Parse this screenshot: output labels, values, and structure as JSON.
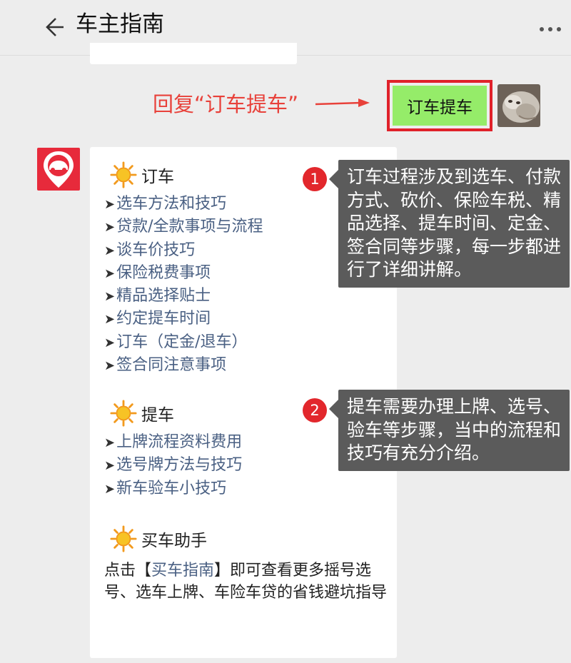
{
  "header": {
    "title": "车主指南",
    "back_icon": "back-arrow-icon",
    "more_icon": "more-dots-icon"
  },
  "annotation_reply": "回复“订车提车”",
  "sent_message": "订车提车",
  "card": {
    "section1": {
      "title": "订车",
      "items": [
        "选车方法和技巧",
        "贷款/全款事项与流程",
        "谈车价技巧",
        "保险税费事项",
        "精品选择贴士",
        "约定提车时间",
        "订车（定金/退车）",
        "签合同注意事项"
      ]
    },
    "section2": {
      "title": "提车",
      "items": [
        "上牌流程资料费用",
        "选号牌方法与技巧",
        "新车验车小技巧"
      ]
    },
    "section3": {
      "title": "买车助手",
      "text_before": "点击【",
      "link": "买车指南",
      "text_after": "】即可查看更多摇号选号、选车上牌、车险车贷的省钱避坑指导"
    },
    "bullet": "➤"
  },
  "callout1": {
    "number": "1",
    "text": "订车过程涉及到选车、付款方式、砍价、保险车税、精品选择、提车时间、定金、签合同等步骤，每一步都进行了详细讲解。"
  },
  "callout2": {
    "number": "2",
    "text": "提车需要办理上牌、选号、验车等步骤，当中的流程和技巧有充分介绍。"
  },
  "colors": {
    "accent_red": "#e2272c",
    "sent_bubble": "#95ec69",
    "link_blue": "#4a6083",
    "tooltip_bg": "#5b5b5b"
  }
}
